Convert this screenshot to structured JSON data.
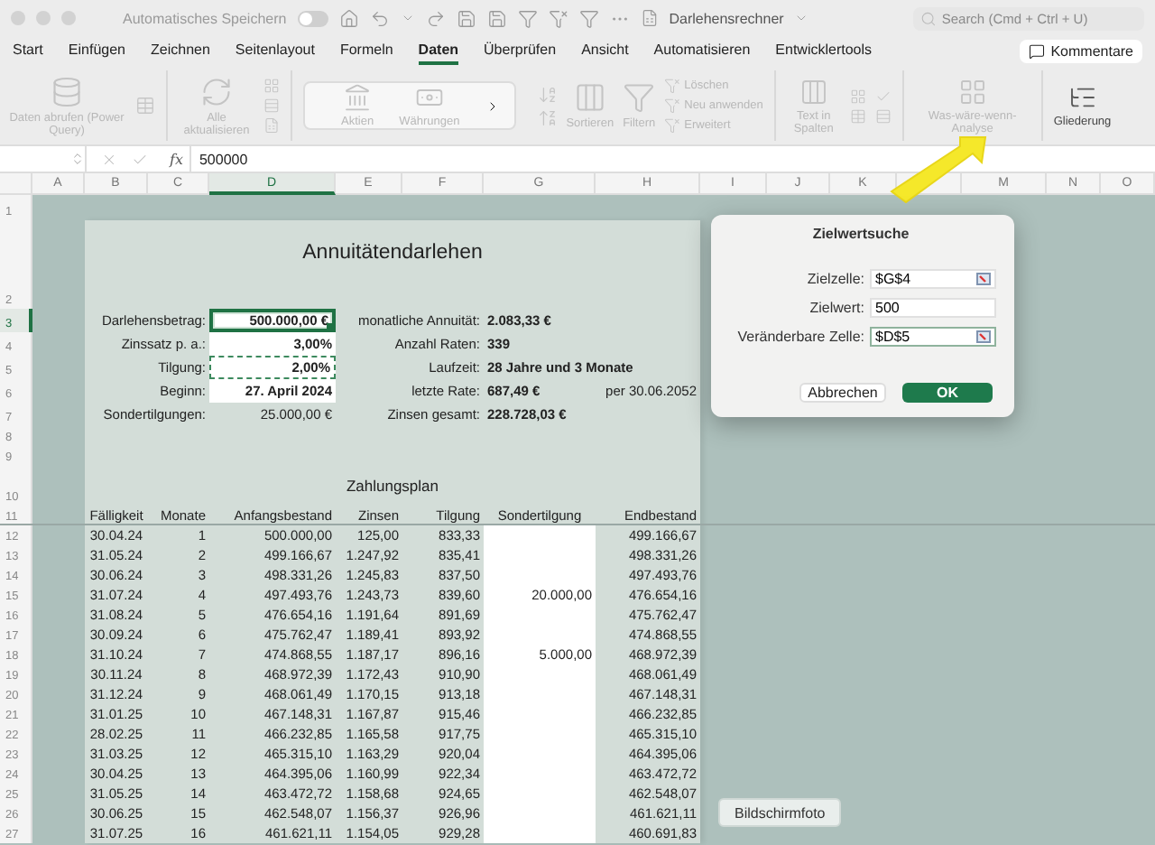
{
  "window": {
    "title": "Darlehensrechner",
    "autosave": {
      "label": "Automatisches Speichern",
      "on": false
    },
    "search": {
      "placeholder": "Search (Cmd + Ctrl + U)"
    }
  },
  "menu_tabs": [
    {
      "label": "Start",
      "selected": false
    },
    {
      "label": "Einfügen",
      "selected": false
    },
    {
      "label": "Zeichnen",
      "selected": false
    },
    {
      "label": "Seitenlayout",
      "selected": false
    },
    {
      "label": "Formeln",
      "selected": false
    },
    {
      "label": "Daten",
      "selected": true
    },
    {
      "label": "Überprüfen",
      "selected": false
    },
    {
      "label": "Ansicht",
      "selected": false
    },
    {
      "label": "Automatisieren",
      "selected": false
    },
    {
      "label": "Entwicklertools",
      "selected": false
    }
  ],
  "comments_button": "Kommentare",
  "ribbon": {
    "get_data": {
      "label": "Daten abrufen (Power Query)",
      "disabled": true
    },
    "refresh": {
      "label": "Alle aktualisieren",
      "disabled": true
    },
    "data_types": [
      {
        "label": "Aktien",
        "disabled": true
      },
      {
        "label": "Währungen",
        "disabled": true
      }
    ],
    "sort": {
      "label": "Sortieren",
      "disabled": true
    },
    "filter": {
      "label": "Filtern",
      "disabled": true
    },
    "filter_options": [
      {
        "label": "Löschen",
        "disabled": true
      },
      {
        "label": "Neu anwenden",
        "disabled": true
      },
      {
        "label": "Erweitert",
        "disabled": true
      }
    ],
    "text_to_columns": {
      "label": "Text in Spalten",
      "disabled": true
    },
    "what_if": {
      "label": "Was-wäre-wenn-Analyse",
      "disabled": true
    },
    "outline": {
      "label": "Gliederung",
      "disabled": false
    }
  },
  "formula_bar": {
    "fx": "fx",
    "value": "500000"
  },
  "columns": [
    {
      "label": "A",
      "selected": false
    },
    {
      "label": "B",
      "selected": false
    },
    {
      "label": "C",
      "selected": false
    },
    {
      "label": "D",
      "selected": true
    },
    {
      "label": "E",
      "selected": false
    },
    {
      "label": "F",
      "selected": false
    },
    {
      "label": "G",
      "selected": false
    },
    {
      "label": "H",
      "selected": false
    },
    {
      "label": "I",
      "selected": false
    },
    {
      "label": "J",
      "selected": false
    },
    {
      "label": "K",
      "selected": false
    },
    {
      "selected": false
    },
    {
      "label": "M",
      "selected": false
    },
    {
      "label": "N",
      "selected": false
    },
    {
      "label": "O",
      "selected": false
    }
  ],
  "row_numbers": [
    {
      "label": "1",
      "selected": false
    },
    {
      "label": "2",
      "selected": false
    },
    {
      "label": "3",
      "selected": true
    },
    {
      "label": "4",
      "selected": false
    },
    {
      "label": "5",
      "selected": false
    },
    {
      "label": "6",
      "selected": false
    },
    {
      "label": "7",
      "selected": false
    },
    {
      "label": "8",
      "selected": false
    },
    {
      "label": "9",
      "selected": false
    },
    {
      "label": "10",
      "selected": false
    },
    {
      "label": "11",
      "selected": false
    },
    {
      "label": "12",
      "selected": false
    },
    {
      "label": "13",
      "selected": false
    },
    {
      "label": "14",
      "selected": false
    },
    {
      "label": "15",
      "selected": false
    },
    {
      "label": "16",
      "selected": false
    },
    {
      "label": "17",
      "selected": false
    },
    {
      "label": "18",
      "selected": false
    },
    {
      "label": "19",
      "selected": false
    },
    {
      "label": "20",
      "selected": false
    },
    {
      "label": "21",
      "selected": false
    },
    {
      "label": "22",
      "selected": false
    },
    {
      "label": "23",
      "selected": false
    },
    {
      "label": "24",
      "selected": false
    },
    {
      "label": "25",
      "selected": false
    },
    {
      "label": "26",
      "selected": false
    },
    {
      "label": "27",
      "selected": false
    }
  ],
  "loan": {
    "title": "Annuitätendarlehen",
    "inputs": [
      {
        "label": "Darlehensbetrag:",
        "value": "500.000,00 €",
        "kind": "input",
        "active": true,
        "copy_marked": false,
        "result_label": "monatliche Annuität:",
        "result": "2.083,33 €"
      },
      {
        "label": "Zinssatz p. a.:",
        "value": "3,00%",
        "kind": "input",
        "active": false,
        "copy_marked": false,
        "result_label": "Anzahl Raten:",
        "result": "339"
      },
      {
        "label": "Tilgung:",
        "value": "2,00%",
        "kind": "input",
        "active": false,
        "copy_marked": true,
        "result_label": "Laufzeit:",
        "result": "28 Jahre und 3 Monate"
      },
      {
        "label": "Beginn:",
        "value": "27. April 2024",
        "kind": "input",
        "active": false,
        "copy_marked": false,
        "result_label": "letzte Rate:",
        "result": "687,49 €",
        "note": "per 30.06.2052"
      },
      {
        "label": "Sondertilgungen:",
        "value": "25.000,00 €",
        "kind": "computed",
        "active": false,
        "copy_marked": false,
        "result_label": "Zinsen gesamt:",
        "result": "228.728,03 €"
      }
    ],
    "schedule_title": "Zahlungsplan",
    "schedule_headers": [
      "Fälligkeit",
      "Monate",
      "Anfangsbestand",
      "Zinsen",
      "Tilgung",
      "Sondertilgung",
      "Endbestand"
    ],
    "schedule": [
      {
        "due": "30.04.24",
        "month": "1",
        "start": "500.000,00",
        "interest": "125,00",
        "repayment": "833,33",
        "end": "499.166,67"
      },
      {
        "due": "31.05.24",
        "month": "2",
        "start": "499.166,67",
        "interest": "1.247,92",
        "repayment": "835,41",
        "end": "498.331,26"
      },
      {
        "due": "30.06.24",
        "month": "3",
        "start": "498.331,26",
        "interest": "1.245,83",
        "repayment": "837,50",
        "end": "497.493,76"
      },
      {
        "due": "31.07.24",
        "month": "4",
        "start": "497.493,76",
        "interest": "1.243,73",
        "repayment": "839,60",
        "extra": "20.000,00",
        "end": "476.654,16"
      },
      {
        "due": "31.08.24",
        "month": "5",
        "start": "476.654,16",
        "interest": "1.191,64",
        "repayment": "891,69",
        "end": "475.762,47"
      },
      {
        "due": "30.09.24",
        "month": "6",
        "start": "475.762,47",
        "interest": "1.189,41",
        "repayment": "893,92",
        "end": "474.868,55"
      },
      {
        "due": "31.10.24",
        "month": "7",
        "start": "474.868,55",
        "interest": "1.187,17",
        "repayment": "896,16",
        "extra": "5.000,00",
        "end": "468.972,39"
      },
      {
        "due": "30.11.24",
        "month": "8",
        "start": "468.972,39",
        "interest": "1.172,43",
        "repayment": "910,90",
        "end": "468.061,49"
      },
      {
        "due": "31.12.24",
        "month": "9",
        "start": "468.061,49",
        "interest": "1.170,15",
        "repayment": "913,18",
        "end": "467.148,31"
      },
      {
        "due": "31.01.25",
        "month": "10",
        "start": "467.148,31",
        "interest": "1.167,87",
        "repayment": "915,46",
        "end": "466.232,85"
      },
      {
        "due": "28.02.25",
        "month": "11",
        "start": "466.232,85",
        "interest": "1.165,58",
        "repayment": "917,75",
        "end": "465.315,10"
      },
      {
        "due": "31.03.25",
        "month": "12",
        "start": "465.315,10",
        "interest": "1.163,29",
        "repayment": "920,04",
        "end": "464.395,06"
      },
      {
        "due": "30.04.25",
        "month": "13",
        "start": "464.395,06",
        "interest": "1.160,99",
        "repayment": "922,34",
        "end": "463.472,72"
      },
      {
        "due": "31.05.25",
        "month": "14",
        "start": "463.472,72",
        "interest": "1.158,68",
        "repayment": "924,65",
        "end": "462.548,07"
      },
      {
        "due": "30.06.25",
        "month": "15",
        "start": "462.548,07",
        "interest": "1.156,37",
        "repayment": "926,96",
        "end": "461.621,11"
      },
      {
        "due": "31.07.25",
        "month": "16",
        "start": "461.621,11",
        "interest": "1.154,05",
        "repayment": "929,28",
        "end": "460.691,83"
      }
    ]
  },
  "dialog": {
    "title": "Zielwertsuche",
    "fields": [
      {
        "label": "Zielzelle:",
        "value": "$G$4",
        "picker": true,
        "focused": false
      },
      {
        "label": "Zielwert:",
        "value": "500",
        "picker": false,
        "focused": false
      },
      {
        "label": "Veränderbare Zelle:",
        "value": "$D$5",
        "picker": true,
        "focused": true
      }
    ],
    "buttons": [
      {
        "label": "Abbrechen",
        "primary": false
      },
      {
        "label": "OK",
        "primary": true
      }
    ]
  },
  "tooltip": "Bildschirmfoto"
}
